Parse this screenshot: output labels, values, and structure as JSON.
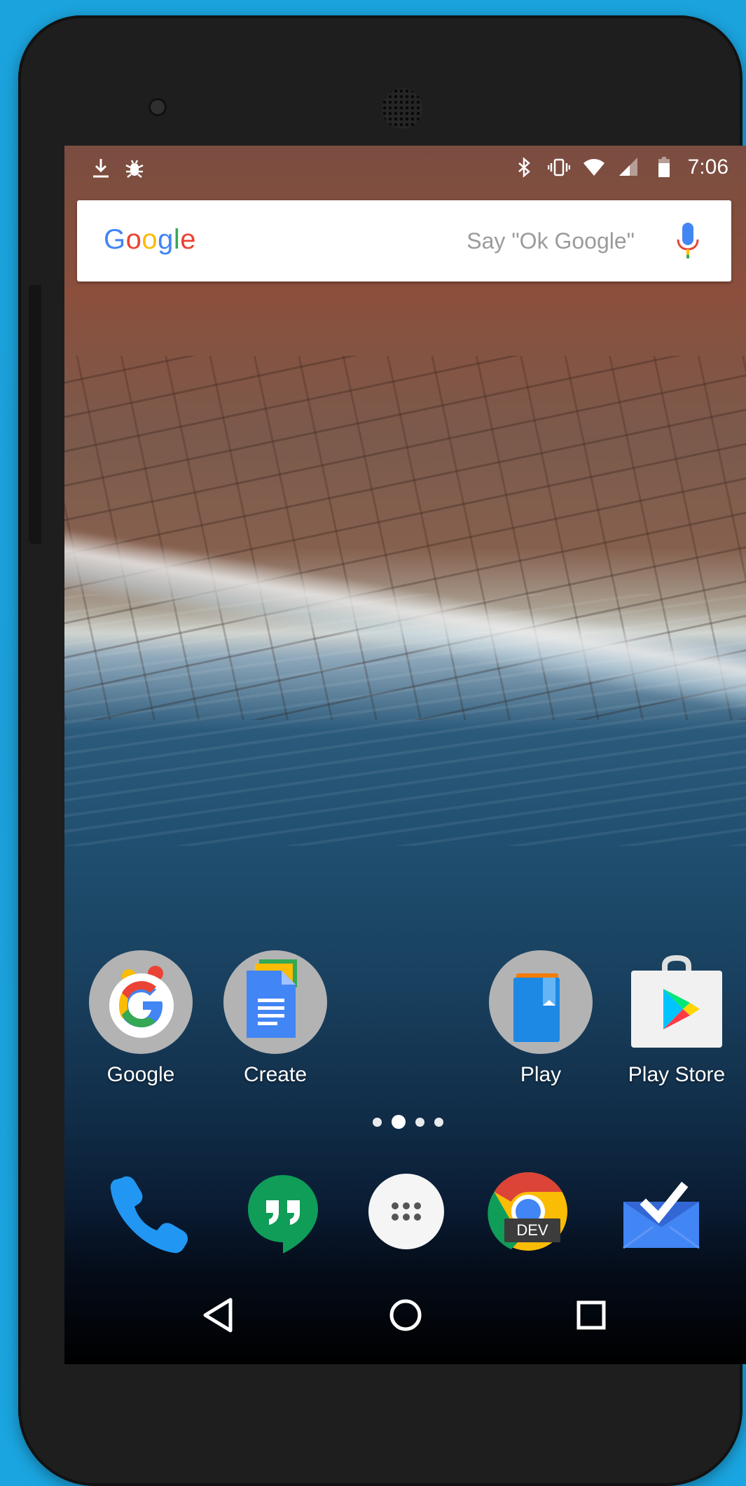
{
  "status_bar": {
    "time": "7:06",
    "left_icons": [
      "download-icon",
      "bug-icon"
    ],
    "right_icons": [
      "bluetooth-icon",
      "vibrate-icon",
      "wifi-icon",
      "signal-icon",
      "battery-icon"
    ]
  },
  "search": {
    "logo": "Google",
    "hint": "Say \"Ok Google\"",
    "icon": "mic-icon",
    "colors": {
      "blue": "#4285f4",
      "red": "#ea4335",
      "yellow": "#fbbc05",
      "green": "#34a853"
    }
  },
  "home_apps": [
    {
      "label": "Google",
      "icon": "google-folder-icon"
    },
    {
      "label": "Create",
      "icon": "create-folder-icon"
    },
    {
      "label": "Play",
      "icon": "play-folder-icon"
    },
    {
      "label": "Play Store",
      "icon": "play-store-icon"
    }
  ],
  "page_indicator": {
    "pages": 4,
    "current": 2
  },
  "dock": [
    {
      "icon": "phone-icon"
    },
    {
      "icon": "hangouts-icon"
    },
    {
      "icon": "app-drawer-icon"
    },
    {
      "icon": "chrome-dev-icon",
      "badge": "DEV"
    },
    {
      "icon": "inbox-icon"
    }
  ],
  "nav": [
    "back-icon",
    "home-icon",
    "recents-icon"
  ]
}
